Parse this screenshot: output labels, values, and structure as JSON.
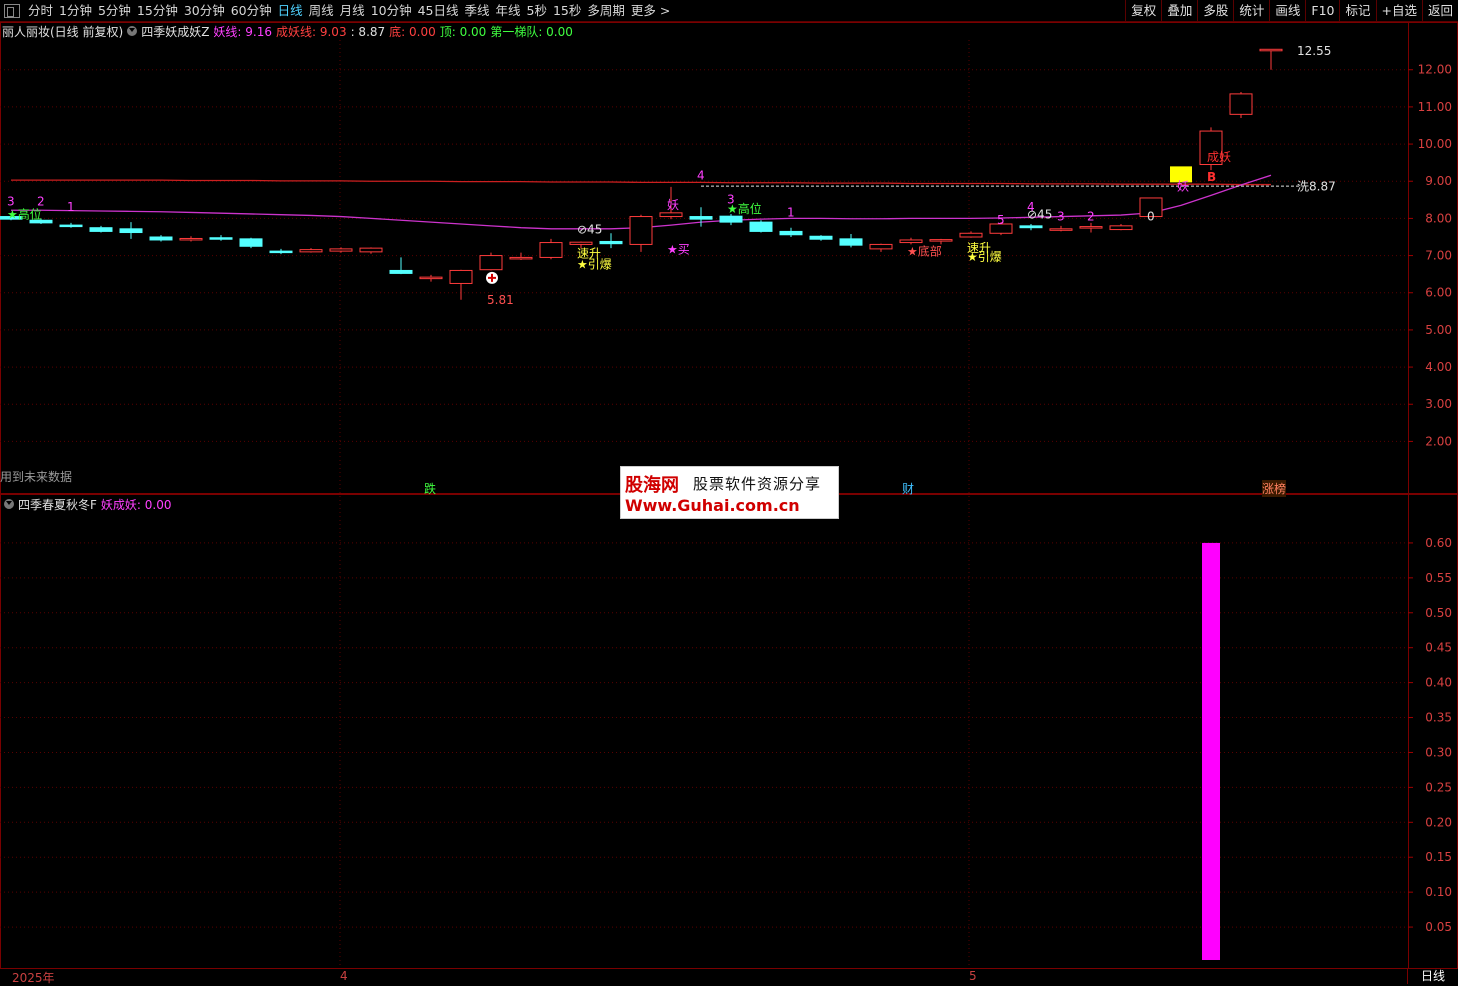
{
  "toolbar": {
    "timeframes": [
      {
        "label": "分时",
        "active": false
      },
      {
        "label": "1分钟",
        "active": false
      },
      {
        "label": "5分钟",
        "active": false
      },
      {
        "label": "15分钟",
        "active": false
      },
      {
        "label": "30分钟",
        "active": false
      },
      {
        "label": "60分钟",
        "active": false
      },
      {
        "label": "日线",
        "active": true
      },
      {
        "label": "周线",
        "active": false
      },
      {
        "label": "月线",
        "active": false
      },
      {
        "label": "10分钟",
        "active": false
      },
      {
        "label": "45日线",
        "active": false
      },
      {
        "label": "季线",
        "active": false
      },
      {
        "label": "年线",
        "active": false
      },
      {
        "label": "5秒",
        "active": false
      },
      {
        "label": "15秒",
        "active": false
      },
      {
        "label": "多周期",
        "active": false
      },
      {
        "label": "更多 >",
        "active": false
      }
    ],
    "tools": [
      "复权",
      "叠加",
      "多股",
      "统计",
      "画线",
      "F10",
      "标记",
      "+自选",
      "返回"
    ]
  },
  "main_info": {
    "stock": "丽人丽妆(日线 前复权)",
    "indicator": "四季妖成妖Z",
    "items": [
      {
        "label": "妖线: 9.16",
        "color": "#ff40ff"
      },
      {
        "label": "成妖线: 9.03",
        "color": "#ff4040"
      },
      {
        "label": ": 8.87",
        "color": "#e0e0e0"
      },
      {
        "label": "底: 0.00",
        "color": "#ff4040"
      },
      {
        "label": "顶: 0.00",
        "color": "#40ff40"
      },
      {
        "label": "第一梯队: 0.00",
        "color": "#40ff40"
      }
    ]
  },
  "sub_info": {
    "indicator": "四季春夏秋冬F",
    "items": [
      {
        "label": "妖成妖: 0.00",
        "color": "#ff40ff"
      }
    ]
  },
  "future_note": "用到未来数据",
  "events": [
    {
      "label": "跌",
      "color": "#40ff40"
    },
    {
      "label": "财",
      "color": "#40c0ff"
    },
    {
      "label": "涨榜",
      "color": "#ff6060"
    }
  ],
  "watermark": {
    "brand": "股海网",
    "slogan": "股票软件资源分享",
    "url": "Www.Guhai.com.cn"
  },
  "dates": [
    "2025年",
    "4",
    "5"
  ],
  "period_tag": "日线",
  "colors": {
    "up": "#ff3c3c",
    "down": "#54ffff",
    "yao_line": "#cc33cc",
    "cheng_yao_line": "#cc2020",
    "bar": "#ff00ff"
  },
  "chart_data": [
    {
      "type": "candlestick",
      "ylim": [
        1.5,
        12.8
      ],
      "y_ticks": [
        12.0,
        11.0,
        10.0,
        9.0,
        8.0,
        7.0,
        6.0,
        5.0,
        4.0,
        3.0,
        2.0
      ],
      "y_tick_labels": [
        "12.00",
        "11.00",
        "10.00",
        "9.00",
        "8.00",
        "7.00",
        "6.00",
        "5.00",
        "4.00",
        "3.00",
        "2.00"
      ],
      "candles": [
        {
          "o": 8.05,
          "h": 8.1,
          "l": 7.95,
          "c": 7.98
        },
        {
          "o": 7.95,
          "h": 8.0,
          "l": 7.85,
          "c": 7.88
        },
        {
          "o": 7.82,
          "h": 7.88,
          "l": 7.75,
          "c": 7.78
        },
        {
          "o": 7.75,
          "h": 7.8,
          "l": 7.62,
          "c": 7.65
        },
        {
          "o": 7.72,
          "h": 7.9,
          "l": 7.45,
          "c": 7.62
        },
        {
          "o": 7.5,
          "h": 7.55,
          "l": 7.38,
          "c": 7.42
        },
        {
          "o": 7.42,
          "h": 7.52,
          "l": 7.38,
          "c": 7.46
        },
        {
          "o": 7.48,
          "h": 7.55,
          "l": 7.4,
          "c": 7.45
        },
        {
          "o": 7.45,
          "h": 7.48,
          "l": 7.2,
          "c": 7.25
        },
        {
          "o": 7.12,
          "h": 7.18,
          "l": 7.04,
          "c": 7.08
        },
        {
          "o": 7.1,
          "h": 7.2,
          "l": 7.08,
          "c": 7.16
        },
        {
          "o": 7.12,
          "h": 7.22,
          "l": 7.08,
          "c": 7.18
        },
        {
          "o": 7.1,
          "h": 7.22,
          "l": 7.05,
          "c": 7.2
        },
        {
          "o": 6.6,
          "h": 6.95,
          "l": 6.5,
          "c": 6.52
        },
        {
          "o": 6.38,
          "h": 6.48,
          "l": 6.3,
          "c": 6.42
        },
        {
          "o": 6.25,
          "h": 6.62,
          "l": 5.81,
          "c": 6.6
        },
        {
          "o": 6.62,
          "h": 7.08,
          "l": 6.6,
          "c": 7.0
        },
        {
          "o": 6.92,
          "h": 7.08,
          "l": 6.88,
          "c": 6.95
        },
        {
          "o": 6.95,
          "h": 7.45,
          "l": 6.9,
          "c": 7.35
        },
        {
          "o": 7.3,
          "h": 7.38,
          "l": 7.2,
          "c": 7.36
        },
        {
          "o": 7.38,
          "h": 7.6,
          "l": 7.2,
          "c": 7.32
        },
        {
          "o": 7.3,
          "h": 8.1,
          "l": 7.1,
          "c": 8.05
        },
        {
          "o": 8.05,
          "h": 8.85,
          "l": 7.98,
          "c": 8.15
        },
        {
          "o": 8.05,
          "h": 8.3,
          "l": 7.78,
          "c": 7.98
        },
        {
          "o": 8.06,
          "h": 8.12,
          "l": 7.82,
          "c": 7.9
        },
        {
          "o": 7.9,
          "h": 7.95,
          "l": 7.62,
          "c": 7.65
        },
        {
          "o": 7.65,
          "h": 7.75,
          "l": 7.5,
          "c": 7.56
        },
        {
          "o": 7.52,
          "h": 7.55,
          "l": 7.4,
          "c": 7.44
        },
        {
          "o": 7.45,
          "h": 7.58,
          "l": 7.22,
          "c": 7.28
        },
        {
          "o": 7.18,
          "h": 7.32,
          "l": 7.1,
          "c": 7.3
        },
        {
          "o": 7.35,
          "h": 7.48,
          "l": 7.3,
          "c": 7.42
        },
        {
          "o": 7.4,
          "h": 7.45,
          "l": 7.3,
          "c": 7.43
        },
        {
          "o": 7.5,
          "h": 7.65,
          "l": 7.48,
          "c": 7.6
        },
        {
          "o": 7.6,
          "h": 7.9,
          "l": 7.55,
          "c": 7.85
        },
        {
          "o": 7.8,
          "h": 7.85,
          "l": 7.68,
          "c": 7.75
        },
        {
          "o": 7.72,
          "h": 7.8,
          "l": 7.65,
          "c": 7.72
        },
        {
          "o": 7.78,
          "h": 7.88,
          "l": 7.62,
          "c": 7.78
        },
        {
          "o": 7.7,
          "h": 7.85,
          "l": 7.68,
          "c": 7.8
        },
        {
          "o": 8.05,
          "h": 8.55,
          "l": 8.05,
          "c": 8.55
        },
        {
          "o": 9.4,
          "h": 9.4,
          "l": 9.4,
          "c": 9.4
        },
        {
          "o": 9.45,
          "h": 10.45,
          "l": 9.3,
          "c": 10.35
        },
        {
          "o": 10.8,
          "h": 11.4,
          "l": 10.7,
          "c": 11.35
        },
        {
          "o": 12.55,
          "h": 12.55,
          "l": 12.0,
          "c": 12.55
        }
      ],
      "yao_line": [
        8.22,
        8.22,
        8.21,
        8.2,
        8.19,
        8.18,
        8.16,
        8.14,
        8.12,
        8.1,
        8.08,
        8.05,
        8.0,
        7.95,
        7.9,
        7.85,
        7.8,
        7.75,
        7.72,
        7.72,
        7.72,
        7.75,
        7.82,
        7.9,
        7.95,
        7.98,
        8.0,
        8.0,
        7.99,
        7.99,
        8.0,
        8.0,
        8.0,
        8.01,
        8.03,
        8.05,
        8.07,
        8.09,
        8.15,
        8.35,
        8.62,
        8.9,
        9.16
      ],
      "cheng_yao_line": [
        9.03,
        9.03,
        9.03,
        9.03,
        9.03,
        9.03,
        9.02,
        9.02,
        9.02,
        9.01,
        9.01,
        9.01,
        9.0,
        9.0,
        9.0,
        8.99,
        8.99,
        8.99,
        8.98,
        8.98,
        8.98,
        8.97,
        8.97,
        8.97,
        8.96,
        8.96,
        8.96,
        8.95,
        8.95,
        8.95,
        8.94,
        8.94,
        8.94,
        8.94,
        8.93,
        8.93,
        8.93,
        8.92,
        8.92,
        8.92,
        8.92,
        8.91,
        8.91
      ],
      "wash_level": 8.87,
      "annotations": [
        {
          "text": "3",
          "i": 0,
          "y": 8.35,
          "color": "#ff40ff"
        },
        {
          "text": "2",
          "i": 1,
          "y": 8.35,
          "color": "#ff40ff"
        },
        {
          "text": "1",
          "i": 2,
          "y": 8.2,
          "color": "#ff40ff"
        },
        {
          "text": "★高位",
          "i": 0,
          "y": 8.0,
          "color": "#40ff40"
        },
        {
          "text": "5.81",
          "i": 16,
          "y": 5.7,
          "color": "#ff5050"
        },
        {
          "text": "⊘45",
          "i": 19,
          "y": 7.6,
          "color": "#e0e0e0"
        },
        {
          "text": "速升",
          "i": 19,
          "y": 6.95,
          "color": "#ffff40"
        },
        {
          "text": "★引爆",
          "i": 19,
          "y": 6.65,
          "color": "#ffff40"
        },
        {
          "text": "4",
          "i": 23,
          "y": 9.05,
          "color": "#ff40ff"
        },
        {
          "text": "妖",
          "i": 22,
          "y": 8.25,
          "color": "#ff40ff"
        },
        {
          "text": "★买",
          "i": 22,
          "y": 7.05,
          "color": "#ff40ff"
        },
        {
          "text": "3",
          "i": 24,
          "y": 8.4,
          "color": "#ff40ff"
        },
        {
          "text": "★高位",
          "i": 24,
          "y": 8.15,
          "color": "#40ff40"
        },
        {
          "text": "1",
          "i": 26,
          "y": 8.05,
          "color": "#ff40ff"
        },
        {
          "text": "★底部",
          "i": 30,
          "y": 7.0,
          "color": "#ff5050"
        },
        {
          "text": "速升",
          "i": 32,
          "y": 7.1,
          "color": "#ffff40"
        },
        {
          "text": "★引爆",
          "i": 32,
          "y": 6.85,
          "color": "#ffff40"
        },
        {
          "text": "5",
          "i": 33,
          "y": 7.85,
          "color": "#ff40ff"
        },
        {
          "text": "4",
          "i": 34,
          "y": 8.2,
          "color": "#ff40ff"
        },
        {
          "text": "⊘45",
          "i": 34,
          "y": 8.0,
          "color": "#e0e0e0"
        },
        {
          "text": "3",
          "i": 35,
          "y": 7.95,
          "color": "#ff40ff"
        },
        {
          "text": "2",
          "i": 36,
          "y": 7.95,
          "color": "#ff40ff"
        },
        {
          "text": "0",
          "i": 38,
          "y": 7.95,
          "color": "#e0e0e0"
        },
        {
          "text": "妖",
          "i": 39,
          "y": 8.75,
          "color": "#ff40ff"
        },
        {
          "text": "B",
          "i": 40,
          "y": 9.0,
          "color": "#ff3030"
        },
        {
          "text": "成妖",
          "i": 40,
          "y": 9.55,
          "color": "#ff3030"
        },
        {
          "text": "12.55",
          "i": 43,
          "y": 12.4,
          "color": "#e0e0e0"
        },
        {
          "text": "洗8.87",
          "i": 43,
          "y": 8.75,
          "color": "#e0e0e0"
        }
      ]
    },
    {
      "type": "bar",
      "ylim": [
        0,
        0.65
      ],
      "y_ticks": [
        0.6,
        0.55,
        0.5,
        0.45,
        0.4,
        0.35,
        0.3,
        0.25,
        0.2,
        0.15,
        0.1,
        0.05
      ],
      "y_tick_labels": [
        "0.60",
        "0.55",
        "0.50",
        "0.45",
        "0.40",
        "0.35",
        "0.30",
        "0.25",
        "0.20",
        "0.15",
        "0.10",
        "0.05"
      ],
      "values_nonzero": [
        {
          "i": 40,
          "v": 0.6
        }
      ],
      "series": [
        {
          "name": "妖成妖",
          "count": 44
        }
      ]
    }
  ]
}
